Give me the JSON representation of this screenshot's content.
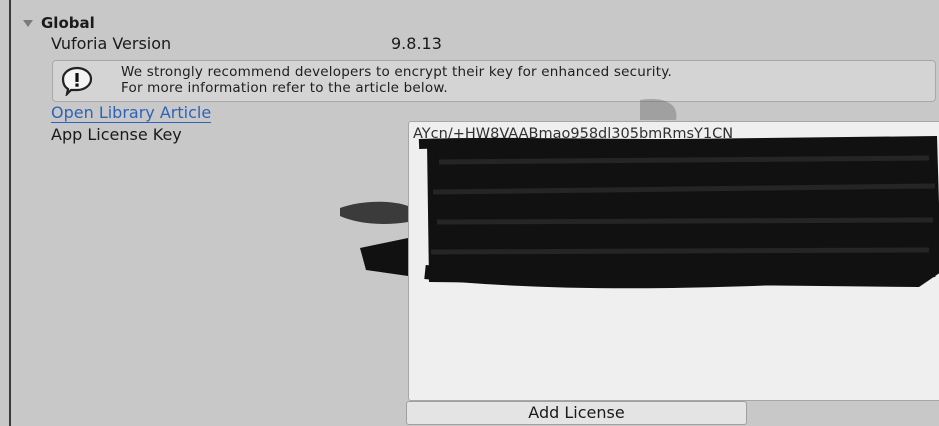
{
  "section": {
    "title": "Global"
  },
  "rows": {
    "version_label": "Vuforia Version",
    "version_value": "9.8.13",
    "license_label": "App License Key"
  },
  "help": {
    "line1": "We strongly recommend developers to encrypt their key for enhanced security.",
    "line2": "For more information refer to the article below.",
    "icon": "warning-icon"
  },
  "link": {
    "label": "Open Library Article"
  },
  "license": {
    "visible_key": "AYcn/+HW8VAABmao958dl305bmRmsY1CN",
    "redacted": true
  },
  "buttons": {
    "add_license": "Add License"
  },
  "colors": {
    "background": "#c8c8c8",
    "link": "#2f62b8",
    "redaction": "#111111"
  }
}
